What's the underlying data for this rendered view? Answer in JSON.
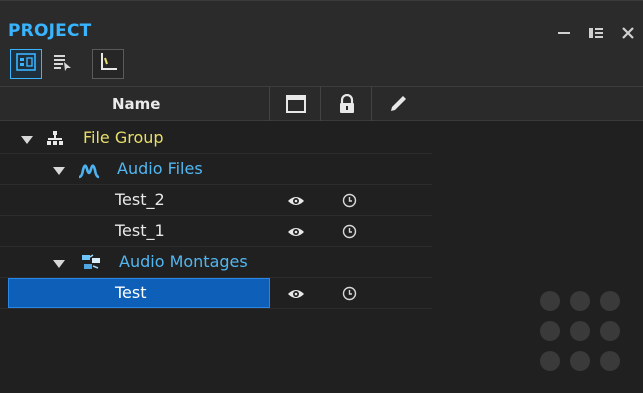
{
  "panel": {
    "title": "PROJECT",
    "controls": [
      "minimize-icon",
      "dock-icon",
      "close-icon"
    ]
  },
  "toolbar": {
    "buttons": [
      {
        "name": "select-group-icon",
        "active": true
      },
      {
        "name": "list-select-icon",
        "active": false
      },
      {
        "name": "tree-view-icon",
        "active": false
      }
    ]
  },
  "columns": {
    "name": "Name",
    "icons": [
      "window-icon",
      "lock-icon",
      "pencil-icon"
    ]
  },
  "tree": {
    "group": {
      "label": "File Group",
      "icon": "hierarchy-icon",
      "expanded": true
    },
    "audio_files": {
      "label": "Audio Files",
      "icon": "waveform-icon",
      "expanded": true,
      "items": [
        {
          "label": "Test_2",
          "visible": true,
          "history": true
        },
        {
          "label": "Test_1",
          "visible": true,
          "history": true
        }
      ]
    },
    "audio_montages": {
      "label": "Audio Montages",
      "icon": "montage-icon",
      "expanded": true,
      "items": [
        {
          "label": "Test",
          "visible": true,
          "history": true,
          "selected": true
        }
      ]
    }
  },
  "colors": {
    "accent": "#39b4ff",
    "group_text": "#e8df6a",
    "folder_text": "#52b7f1",
    "selection": "#0d5fb8"
  }
}
